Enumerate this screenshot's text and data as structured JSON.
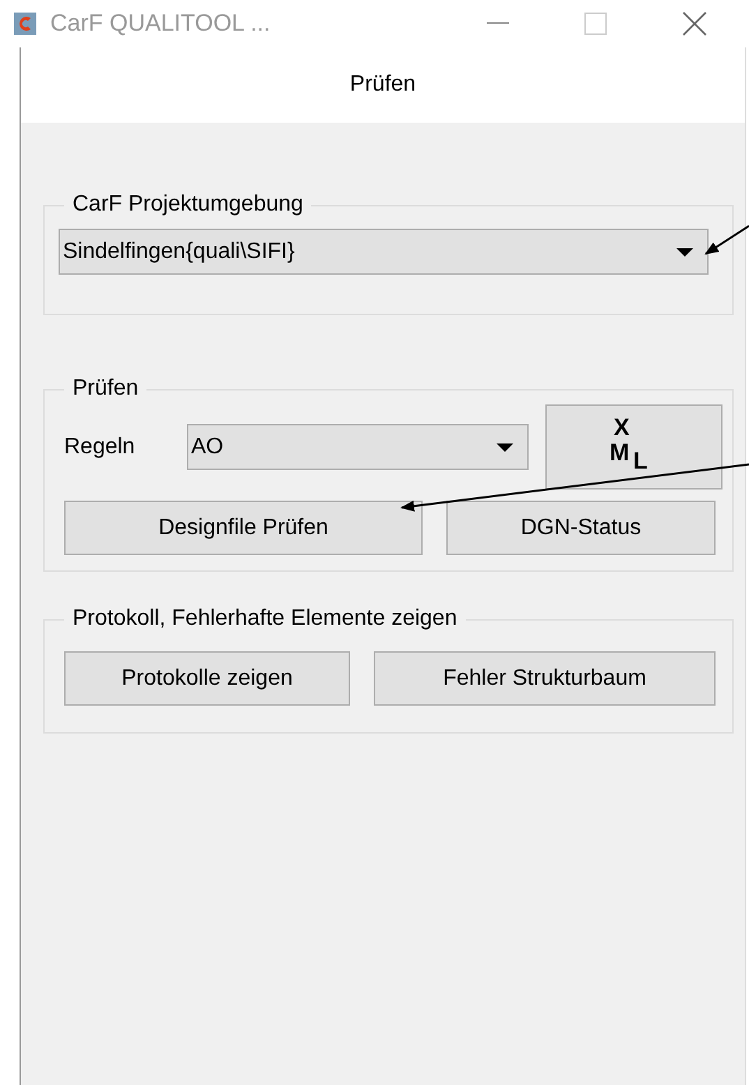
{
  "window": {
    "title": "CarF QUALITOOL ..."
  },
  "panel_title": "Prüfen",
  "environment_group": {
    "title": "CarF Projektumgebung",
    "combo_value": "Sindelfingen{quali\\SIFI}"
  },
  "check_group": {
    "title": "Prüfen",
    "rules_label": "Regeln",
    "rules_value": "AO",
    "xml_button": [
      "X",
      "M",
      "L"
    ],
    "buttons": [
      "Designfile Prüfen",
      "DGN-Status"
    ]
  },
  "protocol_group": {
    "title": "Protokoll, Fehlerhafte Elemente zeigen",
    "buttons": [
      "Protokolle zeigen",
      "Fehler Strukturbaum"
    ]
  }
}
